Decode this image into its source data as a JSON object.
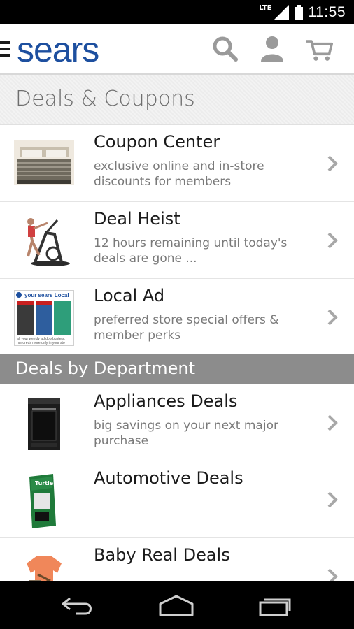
{
  "status_bar": {
    "network": "LTE",
    "time": "11:55"
  },
  "app_bar": {
    "logo_text": "sears",
    "icons": [
      "menu-icon",
      "search-icon",
      "account-icon",
      "cart-icon"
    ]
  },
  "page": {
    "title": "Deals & Coupons"
  },
  "deals": [
    {
      "title": "Coupon Center",
      "subtitle": "exclusive online and in-store discounts for members",
      "thumb": "bed-image"
    },
    {
      "title": "Deal Heist",
      "subtitle": "12 hours remaining until today's deals are gone ...",
      "thumb": "elliptical-image"
    },
    {
      "title": "Local Ad",
      "subtitle": "preferred store special offers & member perks",
      "thumb": "local-ad-image",
      "thumb_text": {
        "header": "your sears Local",
        "footer": "all your weekly ad doorbusters, hundreds more only in your sto"
      }
    }
  ],
  "section": {
    "title": "Deals by Department"
  },
  "departments": [
    {
      "title": "Appliances Deals",
      "subtitle": "big savings on your next major purchase",
      "thumb": "stove-image"
    },
    {
      "title": "Automotive Deals",
      "subtitle": "",
      "thumb": "automotive-product-image",
      "thumb_text": "Turtle"
    },
    {
      "title": "Baby Real Deals",
      "subtitle": "",
      "thumb": "baby-clothes-image"
    }
  ],
  "colors": {
    "brand_blue": "#1d4f9f",
    "section_gray": "#8c8c8c",
    "icon_gray": "#9a9a9a"
  },
  "nav_bar": {
    "icons": [
      "back-icon",
      "home-icon",
      "recent-apps-icon"
    ]
  }
}
